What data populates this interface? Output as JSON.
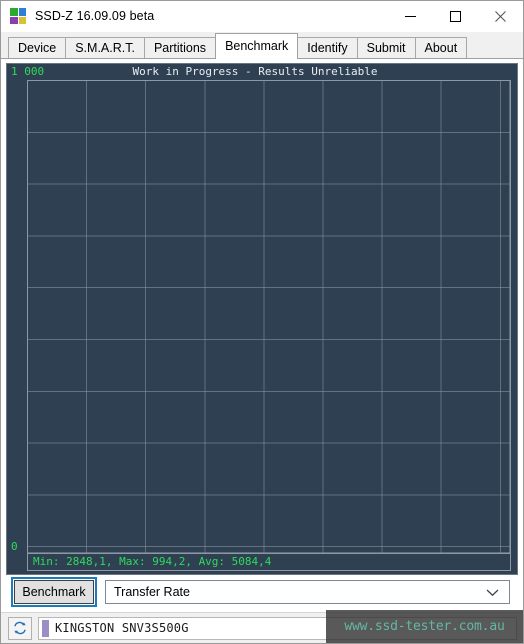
{
  "window": {
    "title": "SSD-Z 16.09.09 beta",
    "icon_name": "ssdz-logo-icon",
    "icon_colors": {
      "top_left": "#2fa82f",
      "top_right": "#2f7fd6",
      "bottom_left": "#8a3fb0",
      "bottom_right": "#d6c32f"
    },
    "controls": {
      "minimize_label": "Minimize",
      "maximize_label": "Maximize",
      "close_label": "Close"
    }
  },
  "tabs": [
    {
      "label": "Device",
      "active": false
    },
    {
      "label": "S.M.A.R.T.",
      "active": false
    },
    {
      "label": "Partitions",
      "active": false
    },
    {
      "label": "Benchmark",
      "active": true
    },
    {
      "label": "Identify",
      "active": false
    },
    {
      "label": "Submit",
      "active": false
    },
    {
      "label": "About",
      "active": false
    }
  ],
  "benchmark": {
    "warning_text": "Work in Progress - Results Unreliable",
    "axis_max_label": "1 000",
    "axis_min_label": "0",
    "stats_line": "Min: 2848,1, Max: 994,2, Avg: 5084,4",
    "colors": {
      "panel_background": "#2e4052",
      "grid_line": "#8d98a4",
      "value_text": "#2ddc5a",
      "warning_text": "#e8eef2"
    }
  },
  "chart_data": {
    "type": "line",
    "title": "Work in Progress - Results Unreliable",
    "xlabel": "",
    "ylabel": "",
    "ylim": [
      0,
      1000
    ],
    "ytick_labels": [
      "1 000",
      "0"
    ],
    "grid": true,
    "grid_columns": 8,
    "grid_rows": 9,
    "legend": "none",
    "series": [
      {
        "name": "Transfer Rate",
        "x": [],
        "values": []
      }
    ],
    "annotations": {
      "min": "2848,1",
      "max": "994,2",
      "avg": "5084,4",
      "stats_line": "Min: 2848,1, Max: 994,2, Avg: 5084,4"
    }
  },
  "controls": {
    "benchmark_button_label": "Benchmark",
    "mode_select_value": "Transfer Rate",
    "mode_select_chevron": "chevron-down-icon"
  },
  "status_bar": {
    "refresh_icon": "refresh-icon",
    "drive_name": "KINGSTON SNV3S500G"
  },
  "watermark": {
    "text": "www.ssd-tester.com.au"
  }
}
